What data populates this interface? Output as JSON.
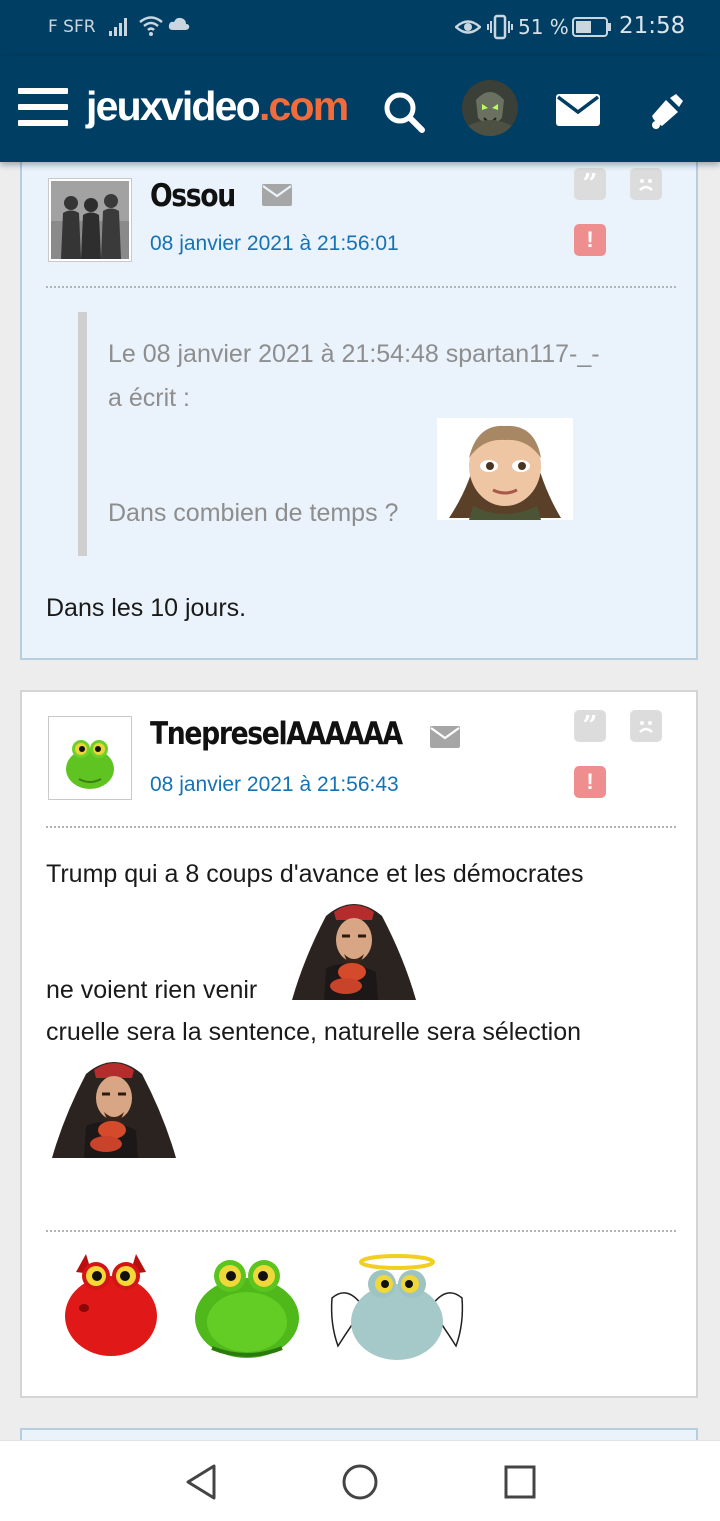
{
  "status_bar": {
    "carrier": "F SFR",
    "battery": "51 %",
    "time": "21:58",
    "icons": [
      "signal-icon",
      "wifi-icon",
      "cloud-icon",
      "eye-icon",
      "vibrate-icon",
      "battery-icon"
    ]
  },
  "header": {
    "logo_main": "jeuxvideo",
    "logo_tld": ".com",
    "icons": [
      "menu-icon",
      "search-icon",
      "user-avatar",
      "mail-icon",
      "notification-icon"
    ],
    "colors": {
      "background": "#003e63",
      "logo_accent": "#f26b3a"
    }
  },
  "posts": [
    {
      "author": "Ossou",
      "date": "08 janvier 2021 à 21:56:01",
      "quote": {
        "header_line1": "Le 08 janvier 2021 à 21:54:48 spartan117-_-",
        "header_line2": "a écrit :",
        "text": "Dans combien de temps ?"
      },
      "body": "Dans les 10 jours."
    },
    {
      "author": "TnepreselAAAAAA",
      "date": "08 janvier 2021 à 21:56:43",
      "body_line1": "Trump qui a 8 coups d'avance et les démocrates",
      "body_line2": "ne voient rien venir",
      "body_line3": "cruelle sera la sentence, naturelle sera sélection"
    }
  ],
  "navigation": {
    "icons": [
      "back-icon",
      "home-icon",
      "recents-icon"
    ]
  },
  "colors": {
    "date_link": "#1673b3",
    "report": "#ef8e8e",
    "highlight_post_bg": "#eaf2fb"
  }
}
